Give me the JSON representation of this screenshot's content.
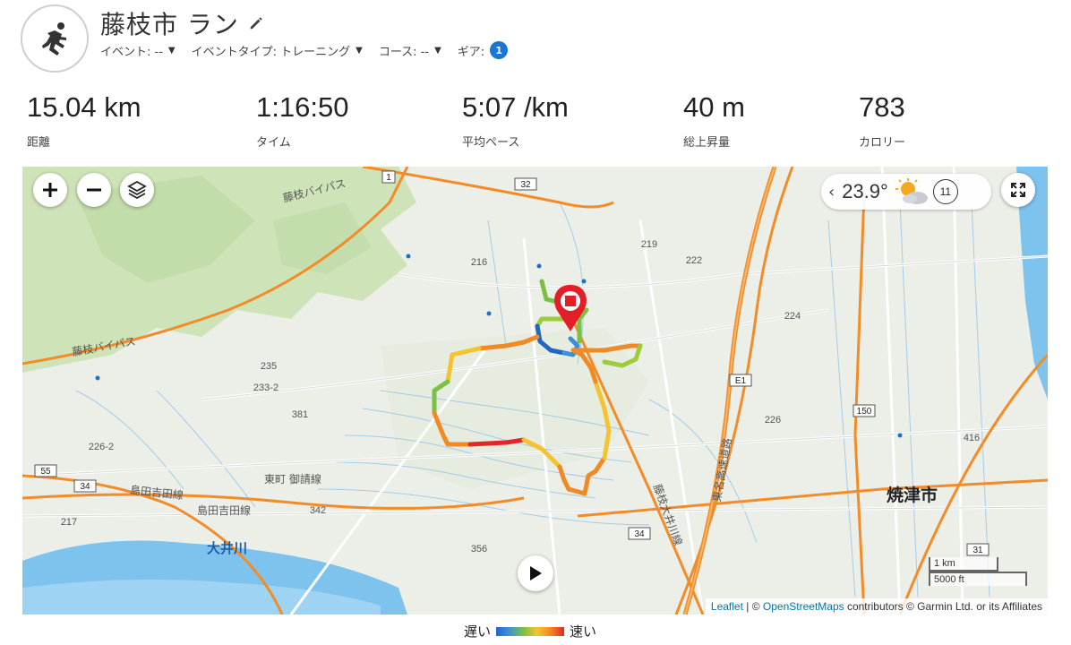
{
  "header": {
    "title": "藤枝市 ラン",
    "meta": [
      {
        "label": "イベント: --"
      },
      {
        "label": "イベントタイプ: トレーニング"
      },
      {
        "label": "コース: --"
      }
    ],
    "gear_label": "ギア:",
    "gear_count": "1"
  },
  "stats": [
    {
      "value": "15.04 km",
      "label": "距離"
    },
    {
      "value": "1:16:50",
      "label": "タイム"
    },
    {
      "value": "5:07 /km",
      "label": "平均ペース"
    },
    {
      "value": "40 m",
      "label": "総上昇量"
    },
    {
      "value": "783",
      "label": "カロリー"
    }
  ],
  "map": {
    "weather_temp": "23.9°",
    "time_badge": "11",
    "scale_metric": "1 km",
    "scale_imperial": "5000 ft",
    "attribution": {
      "leaflet": "Leaflet",
      "sep": " | © ",
      "osm": "OpenStreetMaps",
      "rest": " contributors © Garmin Ltd. or its Affiliates"
    },
    "labels": {
      "city": "焼津市",
      "river": "大井川",
      "bypass1": "藤枝バイパス",
      "bypass2": "藤枝バイパス",
      "road_tomachi": "東町 御請線",
      "road_shimada": "島田吉田線",
      "road_shimada2": "島田吉田線",
      "road_tomei": "東名高速道路",
      "road_fujieda_oigawa": "藤枝大井川線",
      "route_32": "32",
      "route_1": "1",
      "route_150": "150",
      "route_31": "31",
      "route_34a": "34",
      "route_34b": "34",
      "route_55": "55",
      "route_e1": "E1",
      "n222": "222",
      "n224": "224",
      "n226": "226",
      "n416": "416",
      "n235": "235",
      "n233_2": "233-2",
      "n381": "381",
      "n216": "216",
      "n219": "219",
      "n342": "342",
      "n356": "356",
      "n226_2": "226-2",
      "n217": "217"
    }
  },
  "legend": {
    "slow": "遅い",
    "fast": "速い"
  },
  "colors": {
    "accent": "#1976d2",
    "road_major": "#f28c28",
    "water": "#7ec3ee",
    "pin": "#e41e26"
  }
}
